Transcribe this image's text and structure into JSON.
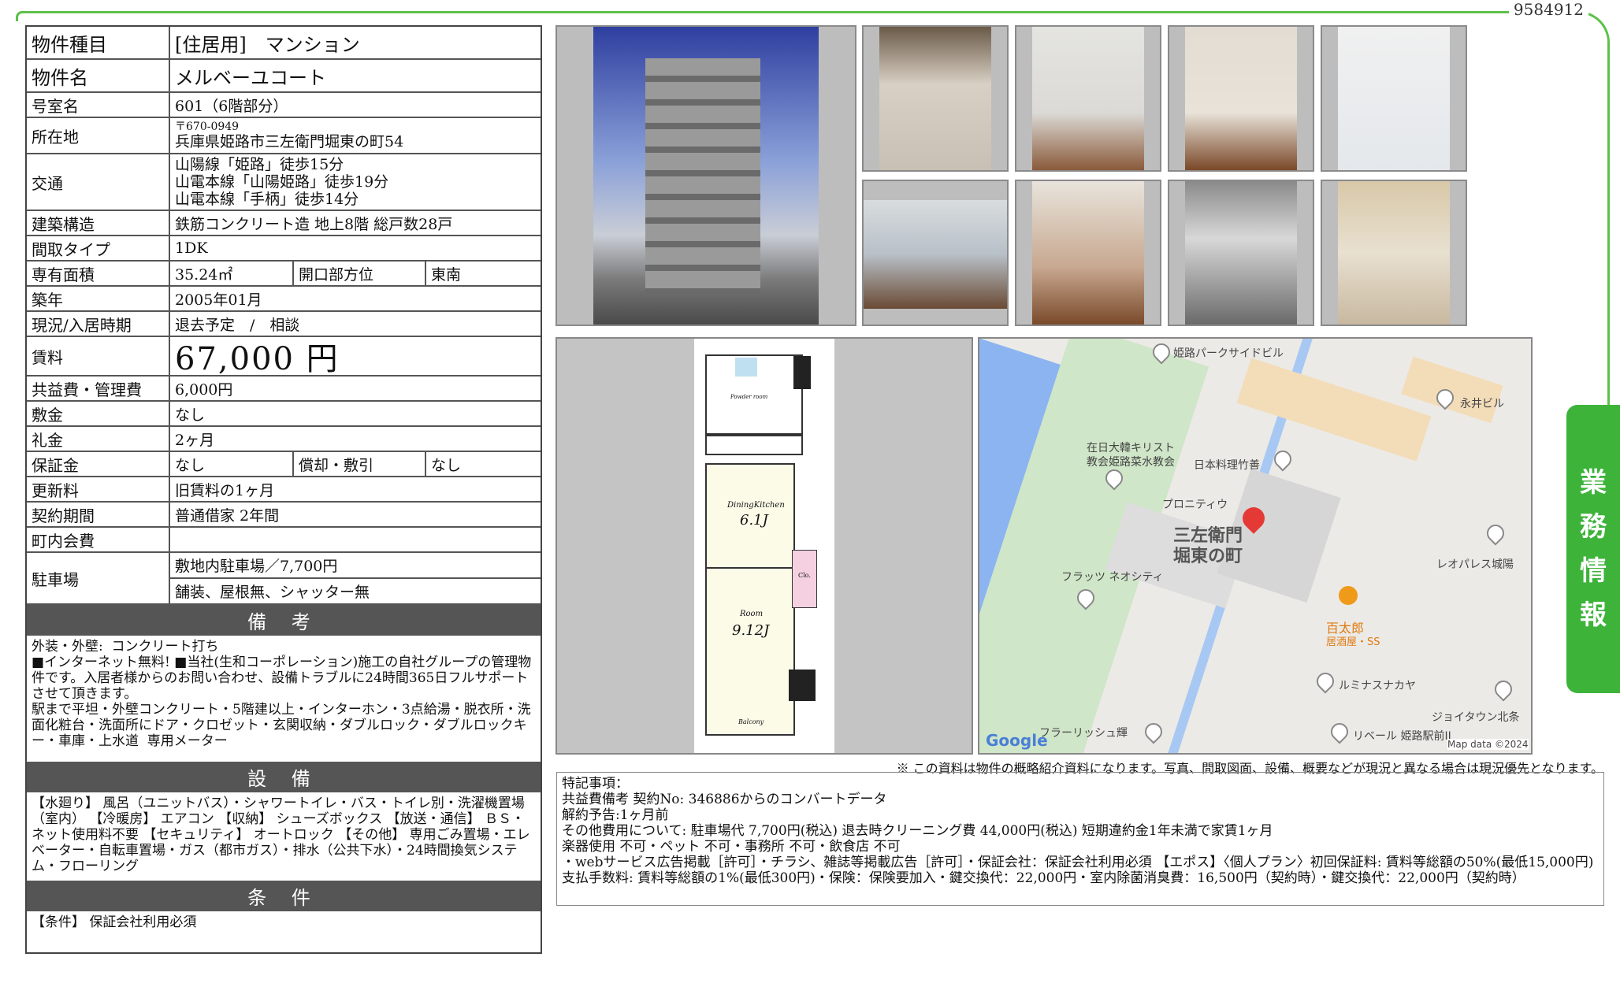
{
  "doc_id": "9584912",
  "side_tab": [
    "業",
    "務",
    "情",
    "報"
  ],
  "spec": {
    "type_label": "物件種目",
    "type_value": "[住居用]　マンション",
    "name_label": "物件名",
    "name_value": "メルベーユコート",
    "room_label": "号室名",
    "room_value": "601（6階部分）",
    "address_label": "所在地",
    "address_zip": "〒670-0949",
    "address_value": "兵庫県姫路市三左衛門堀東の町54",
    "traffic_label": "交通",
    "traffic": [
      "山陽線「姫路」徒歩15分",
      "山電本線「山陽姫路」徒歩19分",
      "山電本線「手柄」徒歩14分"
    ],
    "structure_label": "建築構造",
    "structure_value": "鉄筋コンクリート造  地上8階  総戸数28戸",
    "layout_label": "間取タイプ",
    "layout_value": "1DK",
    "area_label": "専有面積",
    "area_value": "35.24㎡",
    "direction_label": "開口部方位",
    "direction_value": "東南",
    "built_label": "築年",
    "built_value": "2005年01月",
    "status_label": "現況/入居時期",
    "status_value": "退去予定　/　相談",
    "rent_label": "賃料",
    "rent_value": "67,000 円",
    "fee_label": "共益費・管理費",
    "fee_value": "6,000円",
    "deposit_label": "敷金",
    "deposit_value": "なし",
    "key_label": "礼金",
    "key_value": "2ヶ月",
    "guarantee_label": "保証金",
    "guarantee_value": "なし",
    "amort_label": "償却・敷引",
    "amort_value": "なし",
    "renew_label": "更新料",
    "renew_value": "旧賃料の1ヶ月",
    "contract_label": "契約期間",
    "contract_value": "普通借家  2年間",
    "town_label": "町内会費",
    "town_value": "",
    "parking_label": "駐車場",
    "parking_value1": "敷地内駐車場／7,700円",
    "parking_value2": "舗装、屋根無、シャッター無"
  },
  "remarks": {
    "head": "備 考",
    "body": "外装・外壁:  コンクリート打ち\n■インターネット無料! ■当社(生和コーポレーション)施工の自社グループの管理物件です。入居者様からのお問い合わせ、設備トラブルに24時間365日フルサポートさせて頂きます。\n駅まで平坦・外壁コンクリート・5階建以上・インターホン・3点給湯・脱衣所・洗面化粧台・洗面所にドア・クロゼット・玄関収納・ダブルロック・ダブルロックキー・車庫・上水道  専用メーター"
  },
  "equipment": {
    "head": "設 備",
    "body": "【水廻り】  風呂（ユニットバス）・シャワートイレ・バス・トイレ別・洗濯機置場（室内）  【冷暖房】  エアコン  【収納】  シューズボックス  【放送・通信】  ＢＳ・ネット使用料不要  【セキュリティ】  オートロック  【その他】  専用ごみ置場・エレベーター・自転車置場・ガス（都市ガス）・排水（公共下水）・24時間換気システム・フローリング"
  },
  "conditions": {
    "head": "条 件",
    "body": "【条件】  保証会社利用必須"
  },
  "floor_plan": {
    "dk_label": "DiningKitchen",
    "dk_size": "6.1J",
    "room_label": "Room",
    "room_size": "9.12J",
    "balcony": "Balcony",
    "powder": "Powder room",
    "cl": "Clo."
  },
  "map": {
    "labels": [
      "姫路パークサイドビル",
      "永井ビル",
      "在日大韓キリスト",
      "教会姫路菜水教会",
      "日本料理竹善",
      "プロニティウ",
      "三左衛門",
      "堀東の町",
      "レオパレス城陽",
      "フラッツ ネオシティ",
      "百太郎",
      "居酒屋・SS",
      "ルミナスナカヤ",
      "ジョイタウン北条",
      "フラーリッシュ輝",
      "リベール 姫路駅前II",
      "Google",
      "Map data ©2024"
    ]
  },
  "disclaimer": "※ この資料は物件の概略紹介資料になります。写真、間取図面、設備、概要などが現況と異なる場合は現況優先となります。",
  "special": [
    "特記事項：",
    "共益費備考  契約No: 346886からのコンバートデータ",
    "解約予告:1ヶ月前",
    "その他費用について:  駐車場代  7,700円(税込)    退去時クリーニング費  44,000円(税込)    短期違約金1年未満で家賃1ヶ月",
    "楽器使用  不可・ペット  不可・事務所  不可・飲食店  不可",
    "・webサービス広告掲載［許可］・チラシ、雑誌等掲載広告［許可］・保証会社：保証会社利用必須  【エポス】〈個人プラン〉初回保証料: 賃料等総額の50%(最低15,000円)    支払手数料: 賃料等総額の1%(最低300円)・保険：保険要加入・鍵交換代：22,000円・室内除菌消臭費：16,500円（契約時）・鍵交換代：22,000円（契約時）"
  ]
}
